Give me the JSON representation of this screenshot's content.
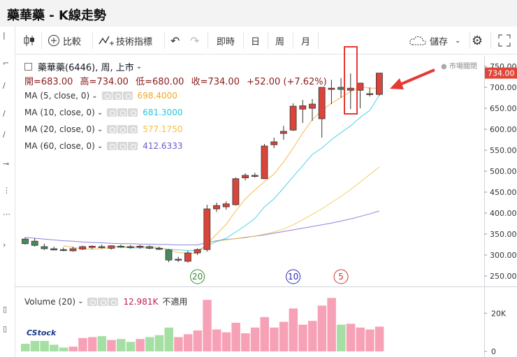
{
  "window": {
    "title": "藥華藥 - K線走勢"
  },
  "toolbar": {
    "compare_label": "比較",
    "indicator_label": "技術指標",
    "intraday_label": "即時",
    "day_label": "日",
    "week_label": "周",
    "month_label": "月",
    "save_label": "儲存"
  },
  "header": {
    "symbol": "藥華藥(6446), 周, 上市",
    "open": "開=683.00",
    "high": "高=734.00",
    "low": "低=680.00",
    "close": "收=734.00",
    "change": "+52.00 (+7.62%)",
    "market_status": "市場關閉"
  },
  "ma_legend": [
    {
      "label": "MA (5, close, 0)",
      "value": "698.4000",
      "color": "#f5a623"
    },
    {
      "label": "MA (10, close, 0)",
      "value": "681.3000",
      "color": "#26c6da"
    },
    {
      "label": "MA (20, close, 0)",
      "value": "577.1750",
      "color": "#f0c040"
    },
    {
      "label": "MA (60, close, 0)",
      "value": "412.6333",
      "color": "#6a5acd"
    }
  ],
  "volume_legend": {
    "label": "Volume (20)",
    "value": "12.981K",
    "note": "不適用"
  },
  "markers": [
    {
      "text": "20",
      "color": "#2e8b2e"
    },
    {
      "text": "10",
      "color": "#2a2aaa"
    },
    {
      "text": "5",
      "color": "#d03030"
    }
  ],
  "last_price_label": "734.00",
  "brand": "CStock",
  "chart_data": {
    "type": "candlestick",
    "ylim": [
      225,
      775
    ],
    "y_ticks": [
      250,
      300,
      350,
      400,
      450,
      500,
      550,
      600,
      650,
      700,
      750
    ],
    "y_tick_labels": [
      "250.00",
      "300.00",
      "350.00",
      "400.00",
      "450.00",
      "500.00",
      "550.00",
      "600.00",
      "650.00",
      "700.00",
      "750.00"
    ],
    "volume_ticks": [
      0,
      20000
    ],
    "volume_tick_labels": [
      "0",
      "20K"
    ],
    "volume_max": 30000,
    "candles": [
      {
        "o": 338,
        "h": 342,
        "l": 325,
        "c": 327,
        "v": 4000
      },
      {
        "o": 333,
        "h": 340,
        "l": 320,
        "c": 323,
        "v": 5500
      },
      {
        "o": 320,
        "h": 327,
        "l": 312,
        "c": 315,
        "v": 5500
      },
      {
        "o": 315,
        "h": 320,
        "l": 311,
        "c": 312,
        "v": 3500
      },
      {
        "o": 313,
        "h": 318,
        "l": 309,
        "c": 311,
        "v": 2000
      },
      {
        "o": 310,
        "h": 320,
        "l": 308,
        "c": 315,
        "v": 2500
      },
      {
        "o": 314,
        "h": 322,
        "l": 312,
        "c": 320,
        "v": 7000
      },
      {
        "o": 318,
        "h": 323,
        "l": 314,
        "c": 321,
        "v": 7500
      },
      {
        "o": 320,
        "h": 325,
        "l": 315,
        "c": 318,
        "v": 8000
      },
      {
        "o": 316,
        "h": 323,
        "l": 313,
        "c": 322,
        "v": 6000
      },
      {
        "o": 321,
        "h": 325,
        "l": 317,
        "c": 320,
        "v": 6500
      },
      {
        "o": 320,
        "h": 324,
        "l": 315,
        "c": 318,
        "v": 5000
      },
      {
        "o": 319,
        "h": 324,
        "l": 315,
        "c": 321,
        "v": 6500
      },
      {
        "o": 320,
        "h": 323,
        "l": 314,
        "c": 316,
        "v": 7500
      },
      {
        "o": 316,
        "h": 320,
        "l": 312,
        "c": 314,
        "v": 8500
      },
      {
        "o": 312,
        "h": 314,
        "l": 283,
        "c": 288,
        "v": 12500
      },
      {
        "o": 290,
        "h": 296,
        "l": 283,
        "c": 290,
        "v": 7500
      },
      {
        "o": 285,
        "h": 310,
        "l": 282,
        "c": 305,
        "v": 9000
      },
      {
        "o": 305,
        "h": 316,
        "l": 300,
        "c": 313,
        "v": 11000
      },
      {
        "o": 313,
        "h": 420,
        "l": 308,
        "c": 410,
        "v": 27000
      },
      {
        "o": 410,
        "h": 425,
        "l": 403,
        "c": 418,
        "v": 11500
      },
      {
        "o": 415,
        "h": 428,
        "l": 408,
        "c": 422,
        "v": 10000
      },
      {
        "o": 420,
        "h": 485,
        "l": 418,
        "c": 482,
        "v": 15000
      },
      {
        "o": 484,
        "h": 495,
        "l": 478,
        "c": 490,
        "v": 9500
      },
      {
        "o": 488,
        "h": 496,
        "l": 485,
        "c": 490,
        "v": 12500
      },
      {
        "o": 482,
        "h": 565,
        "l": 481,
        "c": 560,
        "v": 18000
      },
      {
        "o": 563,
        "h": 580,
        "l": 555,
        "c": 570,
        "v": 12500
      },
      {
        "o": 590,
        "h": 608,
        "l": 575,
        "c": 595,
        "v": 15500
      },
      {
        "o": 598,
        "h": 662,
        "l": 596,
        "c": 655,
        "v": 22500
      },
      {
        "o": 648,
        "h": 670,
        "l": 615,
        "c": 656,
        "v": 14000
      },
      {
        "o": 650,
        "h": 672,
        "l": 620,
        "c": 660,
        "v": 16000
      },
      {
        "o": 625,
        "h": 680,
        "l": 580,
        "c": 700,
        "v": 24000
      },
      {
        "o": 695,
        "h": 718,
        "l": 660,
        "c": 698,
        "v": 28000
      },
      {
        "o": 700,
        "h": 722,
        "l": 675,
        "c": 695,
        "v": 14000
      },
      {
        "o": 693,
        "h": 733,
        "l": 648,
        "c": 698,
        "v": 14500
      },
      {
        "o": 693,
        "h": 711,
        "l": 650,
        "c": 710,
        "v": 12500
      },
      {
        "o": 683,
        "h": 700,
        "l": 678,
        "c": 685,
        "v": 11500
      },
      {
        "o": 683,
        "h": 734,
        "l": 680,
        "c": 734,
        "v": 12981
      }
    ],
    "ma5": [
      null,
      null,
      null,
      null,
      322,
      318,
      315,
      314,
      315,
      318,
      320,
      320,
      320,
      320,
      318,
      312,
      306,
      304,
      304,
      326,
      350,
      373,
      405,
      434,
      455,
      475,
      493,
      522,
      555,
      591,
      623,
      645,
      662,
      676,
      690,
      702,
      698,
      698
    ],
    "ma10": [
      null,
      null,
      null,
      null,
      null,
      null,
      null,
      null,
      null,
      320,
      319,
      317,
      317,
      317,
      316,
      314,
      312,
      311,
      311,
      322,
      332,
      340,
      355,
      370,
      387,
      415,
      434,
      460,
      487,
      513,
      540,
      555,
      575,
      592,
      608,
      628,
      645,
      681
    ],
    "ma20": [
      null,
      null,
      null,
      null,
      null,
      null,
      null,
      null,
      null,
      null,
      null,
      null,
      null,
      null,
      null,
      null,
      null,
      null,
      null,
      330,
      333,
      336,
      339,
      341,
      345,
      350,
      355,
      362,
      372,
      384,
      397,
      410,
      425,
      440,
      456,
      474,
      492,
      510
    ],
    "ma60": [
      342,
      340,
      338,
      336,
      334,
      333,
      331,
      330,
      329,
      328,
      327,
      327,
      326,
      326,
      325,
      325,
      324,
      324,
      324,
      330,
      334,
      337,
      339,
      342,
      345,
      348,
      352,
      356,
      360,
      364,
      368,
      372,
      376,
      381,
      386,
      392,
      398,
      405
    ]
  }
}
